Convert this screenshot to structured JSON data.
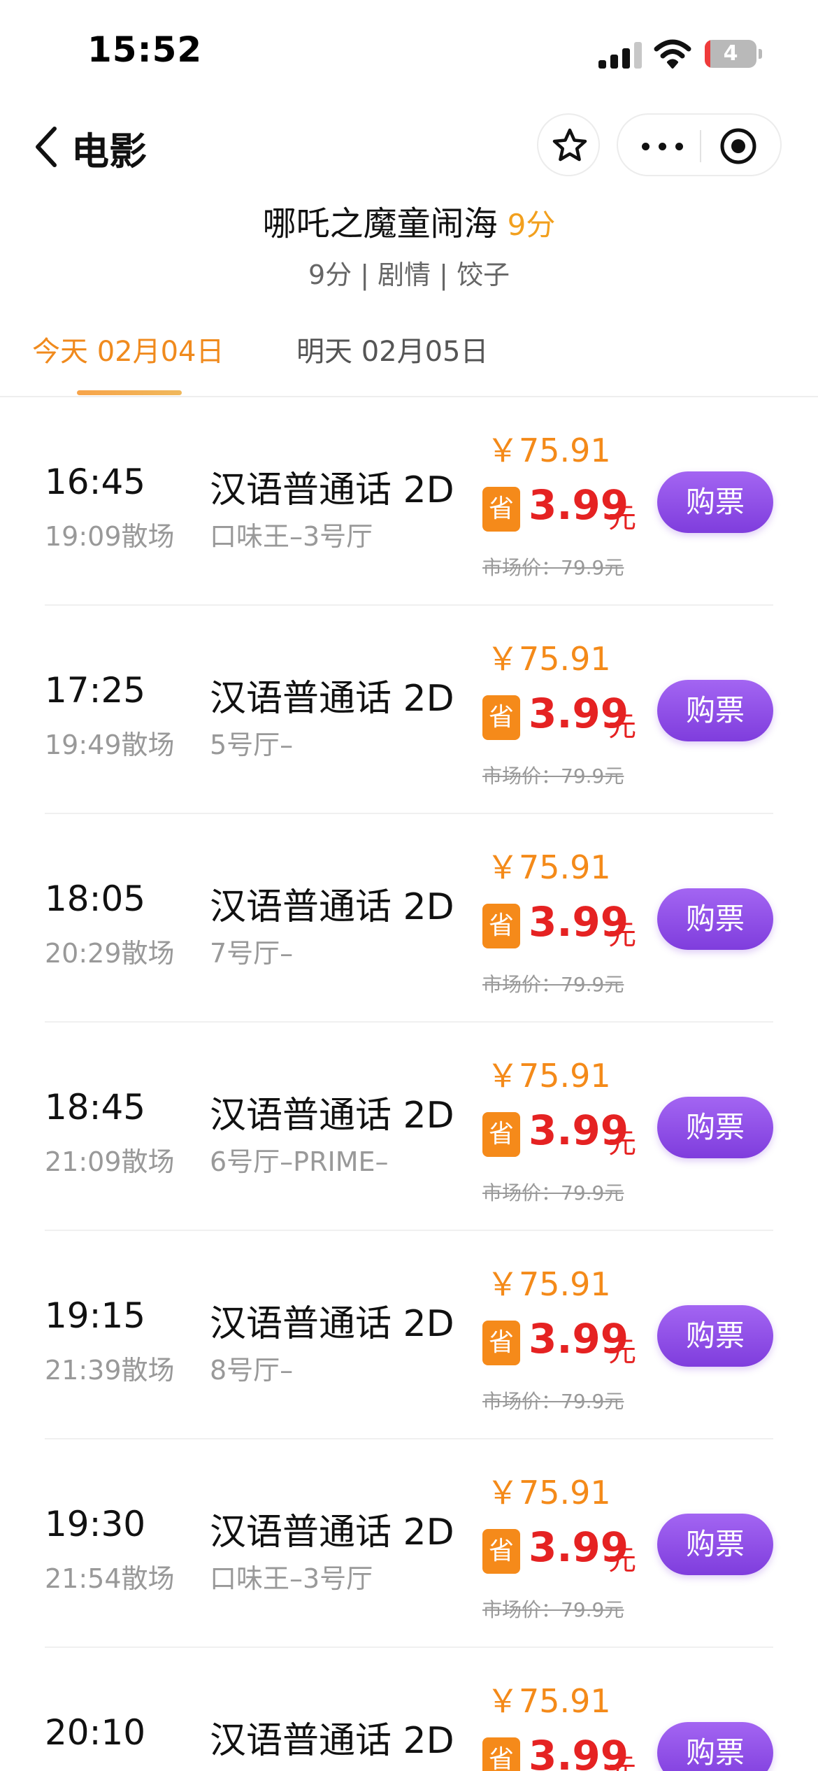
{
  "status_bar": {
    "time": "15:52",
    "battery_level": "4",
    "battery_fraction": 0.04
  },
  "nav": {
    "title": "电影"
  },
  "movie": {
    "title": "哪吒之魔童闹海",
    "score": "9分",
    "tags": "9分 | 剧情 | 饺子"
  },
  "date_tabs": [
    {
      "label": "今天 02月04日",
      "active": true
    },
    {
      "label": "明天 02月05日",
      "active": false
    }
  ],
  "labels": {
    "save_badge": "省",
    "currency_unit": "元",
    "buy": "购票"
  },
  "colors": {
    "accent_orange": "#f08a1d",
    "discount_red": "#e52222",
    "buy_purple": "#8b47e6"
  },
  "showtimes": [
    {
      "start": "16:45",
      "end": "19:09散场",
      "lang": "汉语普通话 2D",
      "hall": "口味王–3号厅",
      "price": "￥75.91",
      "discount": "3.99",
      "market": "市场价：79.9元"
    },
    {
      "start": "17:25",
      "end": "19:49散场",
      "lang": "汉语普通话 2D",
      "hall": "5号厅–",
      "price": "￥75.91",
      "discount": "3.99",
      "market": "市场价：79.9元"
    },
    {
      "start": "18:05",
      "end": "20:29散场",
      "lang": "汉语普通话 2D",
      "hall": "7号厅–",
      "price": "￥75.91",
      "discount": "3.99",
      "market": "市场价：79.9元"
    },
    {
      "start": "18:45",
      "end": "21:09散场",
      "lang": "汉语普通话 2D",
      "hall": "6号厅–PRIME–",
      "price": "￥75.91",
      "discount": "3.99",
      "market": "市场价：79.9元"
    },
    {
      "start": "19:15",
      "end": "21:39散场",
      "lang": "汉语普通话 2D",
      "hall": "8号厅–",
      "price": "￥75.91",
      "discount": "3.99",
      "market": "市场价：79.9元"
    },
    {
      "start": "19:30",
      "end": "21:54散场",
      "lang": "汉语普通话 2D",
      "hall": "口味王–3号厅",
      "price": "￥75.91",
      "discount": "3.99",
      "market": "市场价：79.9元"
    },
    {
      "start": "20:10",
      "end": "",
      "lang": "汉语普通话 2D",
      "hall": "",
      "price": "￥75.91",
      "discount": "3.99",
      "market": ""
    }
  ]
}
